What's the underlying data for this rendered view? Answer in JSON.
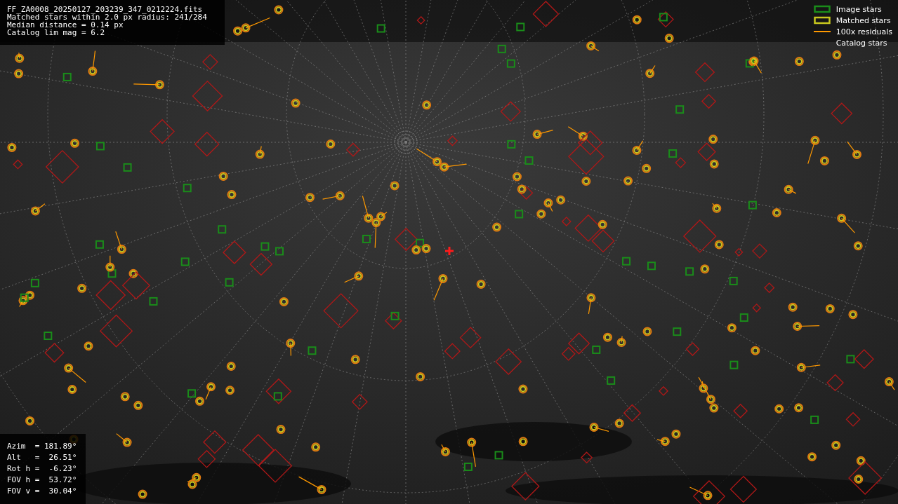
{
  "info": {
    "lines": [
      "FF_ZA0008_20250127_203239_347_0212224.fits",
      "Matched stars within 2.0 px radius: 241/284",
      "Median distance = 0.14 px",
      "Catalog lim mag = 6.2"
    ]
  },
  "legend": [
    {
      "kind": "box",
      "color": "#1a8c1a",
      "label": "Image stars"
    },
    {
      "kind": "box",
      "color": "#c8c81e",
      "label": "Matched stars"
    },
    {
      "kind": "line",
      "color": "#ff9900",
      "label": "100x residuals"
    },
    {
      "kind": "none",
      "label": "Catalog stars"
    }
  ],
  "pointing": {
    "lines": [
      "Azim  = 181.89°",
      "Alt   =  26.51°",
      "Rot h =  -6.23°",
      "FOV h =  53.72°",
      "FOV v =  30.04°"
    ]
  }
}
